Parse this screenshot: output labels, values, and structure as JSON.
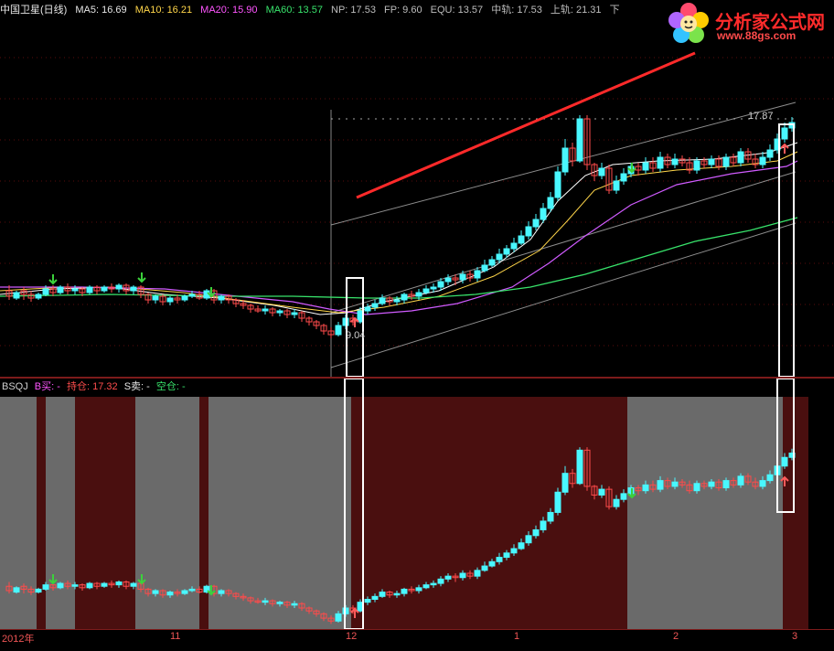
{
  "header": {
    "stock_name": "中国卫星(日线)",
    "ma5": "MA5: 16.69",
    "ma10": "MA10: 16.21",
    "ma20": "MA20: 15.90",
    "ma60": "MA60: 13.57",
    "np": "NP: 17.53",
    "fp": "FP: 9.60",
    "equ": "EQU: 13.57",
    "mid_rail": "中轨: 17.53",
    "upper_rail": "上轨: 21.31",
    "lower_cut": "下"
  },
  "logo": {
    "title": "分析家公式网",
    "url": "www.88gs.com",
    "colors": [
      "#ff2b2b",
      "#ff4b4b",
      "#ffcc00",
      "#00ccff"
    ]
  },
  "annotations": {
    "top_high": "17.87",
    "bottom_low": "9.04"
  },
  "bottom_legend": {
    "indicator": "BSQJ",
    "buy": "B买: -",
    "hold": "持仓: 17.32",
    "sell": "S卖: -",
    "empty": "空仓: -"
  },
  "time_axis": {
    "ticks": [
      "2012年",
      "11",
      "12",
      "1",
      "2",
      "3"
    ]
  },
  "colors": {
    "up": "#ff4b4b",
    "down": "#49f7ff",
    "buy_signal": "#3bd13b",
    "sell_signal": "#ff5b5b",
    "ma5": "#ffffff",
    "ma10": "#ffd64a",
    "ma20": "#d05bff",
    "ma60": "#38e36b",
    "channel": "#bdbdbd",
    "trendline": "#ff2a2a",
    "hold_bg": "#4a0f0f",
    "empty_bg": "#6a6a6a",
    "box": "#ffffff"
  }
}
